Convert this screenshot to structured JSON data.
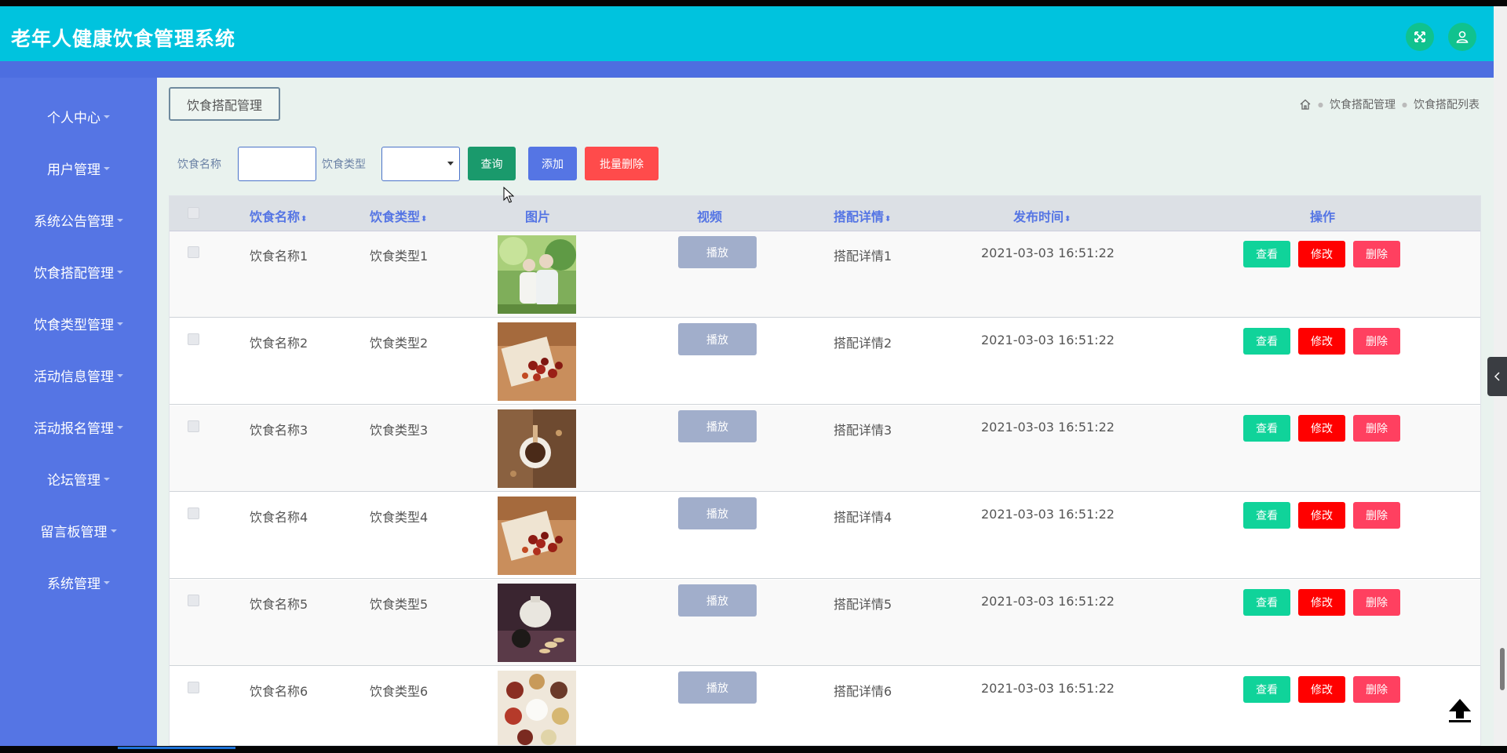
{
  "app": {
    "title": "老年人健康饮食管理系统"
  },
  "header": {
    "icons": [
      "fullscreen-icon",
      "user-icon"
    ]
  },
  "sidebar": {
    "items": [
      {
        "label": "个人中心"
      },
      {
        "label": "用户管理"
      },
      {
        "label": "系统公告管理"
      },
      {
        "label": "饮食搭配管理"
      },
      {
        "label": "饮食类型管理"
      },
      {
        "label": "活动信息管理"
      },
      {
        "label": "活动报名管理"
      },
      {
        "label": "论坛管理"
      },
      {
        "label": "留言板管理"
      },
      {
        "label": "系统管理"
      }
    ]
  },
  "page": {
    "title": "饮食搭配管理",
    "breadcrumb": [
      "饮食搭配管理",
      "饮食搭配列表"
    ]
  },
  "filters": {
    "name_label": "饮食名称",
    "name_value": "",
    "type_label": "饮食类型",
    "type_value": "",
    "search_button": "查询",
    "add_button": "添加",
    "batch_delete_button": "批量删除"
  },
  "table": {
    "columns": [
      "饮食名称",
      "饮食类型",
      "图片",
      "视频",
      "搭配详情",
      "发布时间",
      "操作"
    ],
    "sort_glyph": "⬍",
    "play_label": "播放",
    "view_label": "查看",
    "edit_label": "修改",
    "delete_label": "删除",
    "rows": [
      {
        "name": "饮食名称1",
        "type": "饮食类型1",
        "image": "elderly-couple-photo",
        "detail": "搭配详情1",
        "time": "2021-03-03 16:51:22"
      },
      {
        "name": "饮食名称2",
        "type": "饮食类型2",
        "image": "dried-dates-photo",
        "detail": "搭配详情2",
        "time": "2021-03-03 16:51:22"
      },
      {
        "name": "饮食名称3",
        "type": "饮食类型3",
        "image": "herbal-bowl-photo",
        "detail": "搭配详情3",
        "time": "2021-03-03 16:51:22"
      },
      {
        "name": "饮食名称4",
        "type": "饮食类型4",
        "image": "dried-dates-photo",
        "detail": "搭配详情4",
        "time": "2021-03-03 16:51:22"
      },
      {
        "name": "饮食名称5",
        "type": "饮食类型5",
        "image": "teapot-nuts-photo",
        "detail": "搭配详情5",
        "time": "2021-03-03 16:51:22"
      },
      {
        "name": "饮食名称6",
        "type": "饮食类型6",
        "image": "grain-bowls-photo",
        "detail": "搭配详情6",
        "time": "2021-03-03 16:51:22"
      }
    ]
  },
  "colors": {
    "topbar": "#00c3de",
    "sidebar": "#5575e4",
    "search": "#1a9a6c",
    "add": "#5575e4",
    "batch_delete": "#ff4b4b",
    "view": "#10d39a",
    "edit": "#ff0000",
    "delete": "#ff4060",
    "play": "#a1aecb"
  }
}
